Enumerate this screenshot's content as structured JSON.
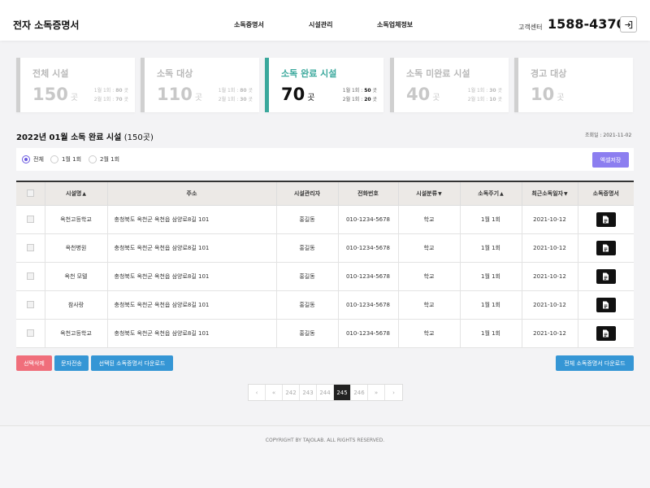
{
  "header": {
    "brand": "전자 소독증명서",
    "nav": [
      "소독증명서",
      "시설관리",
      "소독업체정보"
    ],
    "cs_label": "고객센터",
    "cs_phone": "1588-4370",
    "logout_icon": "logout-icon"
  },
  "stats": [
    {
      "title": "전체 시설",
      "value": "150",
      "unit": "곳",
      "b1_label": "1월 1회 :",
      "b1_value": "80",
      "b1_unit": "곳",
      "b2_label": "2월 1회 :",
      "b2_value": "70",
      "b2_unit": "곳"
    },
    {
      "title": "소독 대상",
      "value": "110",
      "unit": "곳",
      "b1_label": "1월 1회 :",
      "b1_value": "80",
      "b1_unit": "곳",
      "b2_label": "2월 1회 :",
      "b2_value": "30",
      "b2_unit": "곳"
    },
    {
      "title": "소독 완료 시설",
      "value": "70",
      "unit": "곳",
      "b1_label": "1월 1회 :",
      "b1_value": "50",
      "b1_unit": "곳",
      "b2_label": "2월 1회 :",
      "b2_value": "20",
      "b2_unit": "곳"
    },
    {
      "title": "소독 미완료 시설",
      "value": "40",
      "unit": "곳",
      "b1_label": "1월 1회 :",
      "b1_value": "30",
      "b1_unit": "곳",
      "b2_label": "2월 1회 :",
      "b2_value": "10",
      "b2_unit": "곳"
    },
    {
      "title": "경고 대상",
      "value": "10",
      "unit": "곳"
    }
  ],
  "section": {
    "title": "2022년 01월 소독 완료 시설",
    "count": "(150곳)",
    "query_date": "조회일 : 2021-11-02"
  },
  "filter": {
    "options": [
      "전체",
      "1월 1회",
      "2월 1회"
    ],
    "selected": "전체",
    "excel_label": "엑셀저장"
  },
  "table": {
    "headers": [
      "시설명",
      "주소",
      "시설관리자",
      "전화번호",
      "시설분류",
      "소독주기",
      "최근소독일자",
      "소독증명서"
    ],
    "sort_marks": [
      "▲",
      "",
      "",
      "",
      "▼",
      "▲",
      "▼",
      ""
    ],
    "rows": [
      [
        "옥천고등학교",
        "충청북도 옥천군 옥천읍 삼양로8길 101",
        "홍길동",
        "010-1234-5678",
        "학교",
        "1월 1회",
        "2021-10-12"
      ],
      [
        "옥천병원",
        "충청북도 옥천군 옥천읍 삼양로8길 101",
        "홍길동",
        "010-1234-5678",
        "학교",
        "1월 1회",
        "2021-10-12"
      ],
      [
        "옥천 모텔",
        "충청북도 옥천군 옥천읍 삼양로8길 101",
        "홍길동",
        "010-1234-5678",
        "학교",
        "1월 1회",
        "2021-10-12"
      ],
      [
        "참사랑",
        "충청북도 옥천군 옥천읍 삼양로8길 101",
        "홍길동",
        "010-1234-5678",
        "학교",
        "1월 1회",
        "2021-10-12"
      ],
      [
        "옥천고등학교",
        "충청북도 옥천군 옥천읍 삼양로8길 101",
        "홍길동",
        "010-1234-5678",
        "학교",
        "1월 1회",
        "2021-10-12"
      ]
    ]
  },
  "actions": {
    "delete_selected": "선택삭제",
    "send_sms": "문자전송",
    "download_selected": "선택된 소독증명서 다운로드",
    "download_all": "전체 소독증명서 다운로드"
  },
  "pagination": {
    "first": "‹",
    "prev": "«",
    "pages": [
      "242",
      "243",
      "244",
      "245",
      "246"
    ],
    "current": "245",
    "next": "»",
    "last": "›"
  },
  "footer": {
    "copyright": "COPYRIGHT BY TAJOLAB. ALL RIGHTS RESERVED."
  },
  "colors": {
    "accent_teal": "#3aa89c",
    "accent_purple": "#8c7ef0",
    "danger": "#f06e7b",
    "primary_blue": "#3596d5"
  }
}
